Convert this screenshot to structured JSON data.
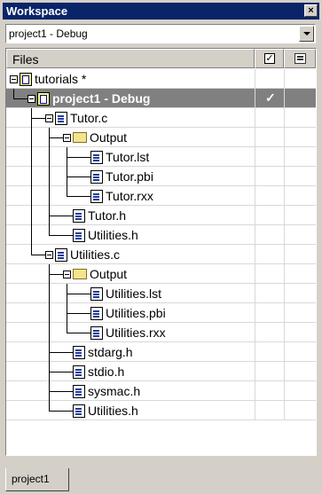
{
  "window": {
    "title": "Workspace",
    "close_glyph": "×"
  },
  "config_select": {
    "value": "project1 - Debug"
  },
  "tree_header": {
    "files_label": "Files",
    "check_glyph": "✓"
  },
  "tree": [
    {
      "label": "tutorials *",
      "icon": "workspace-icon",
      "level": 0,
      "expandable": true
    },
    {
      "label": "project1 - Debug",
      "icon": "project-icon",
      "level": 1,
      "expandable": true,
      "selected": true,
      "checked": true
    },
    {
      "label": "Tutor.c",
      "icon": "file-icon",
      "level": 2,
      "expandable": true
    },
    {
      "label": "Output",
      "icon": "folder-icon",
      "level": 3,
      "expandable": true
    },
    {
      "label": "Tutor.lst",
      "icon": "file-icon",
      "level": 4
    },
    {
      "label": "Tutor.pbi",
      "icon": "file-icon",
      "level": 4
    },
    {
      "label": "Tutor.rxx",
      "icon": "file-icon",
      "level": 4
    },
    {
      "label": "Tutor.h",
      "icon": "file-icon",
      "level": 3
    },
    {
      "label": "Utilities.h",
      "icon": "file-icon",
      "level": 3
    },
    {
      "label": "Utilities.c",
      "icon": "file-icon",
      "level": 2,
      "expandable": true
    },
    {
      "label": "Output",
      "icon": "folder-icon",
      "level": 3,
      "expandable": true
    },
    {
      "label": "Utilities.lst",
      "icon": "file-icon",
      "level": 4
    },
    {
      "label": "Utilities.pbi",
      "icon": "file-icon",
      "level": 4
    },
    {
      "label": "Utilities.rxx",
      "icon": "file-icon",
      "level": 4
    },
    {
      "label": "stdarg.h",
      "icon": "file-icon",
      "level": 3
    },
    {
      "label": "stdio.h",
      "icon": "file-icon",
      "level": 3
    },
    {
      "label": "sysmac.h",
      "icon": "file-icon",
      "level": 3
    },
    {
      "label": "Utilities.h",
      "icon": "file-icon",
      "level": 3
    }
  ],
  "tabs": [
    {
      "label": "project1",
      "active": true
    }
  ]
}
